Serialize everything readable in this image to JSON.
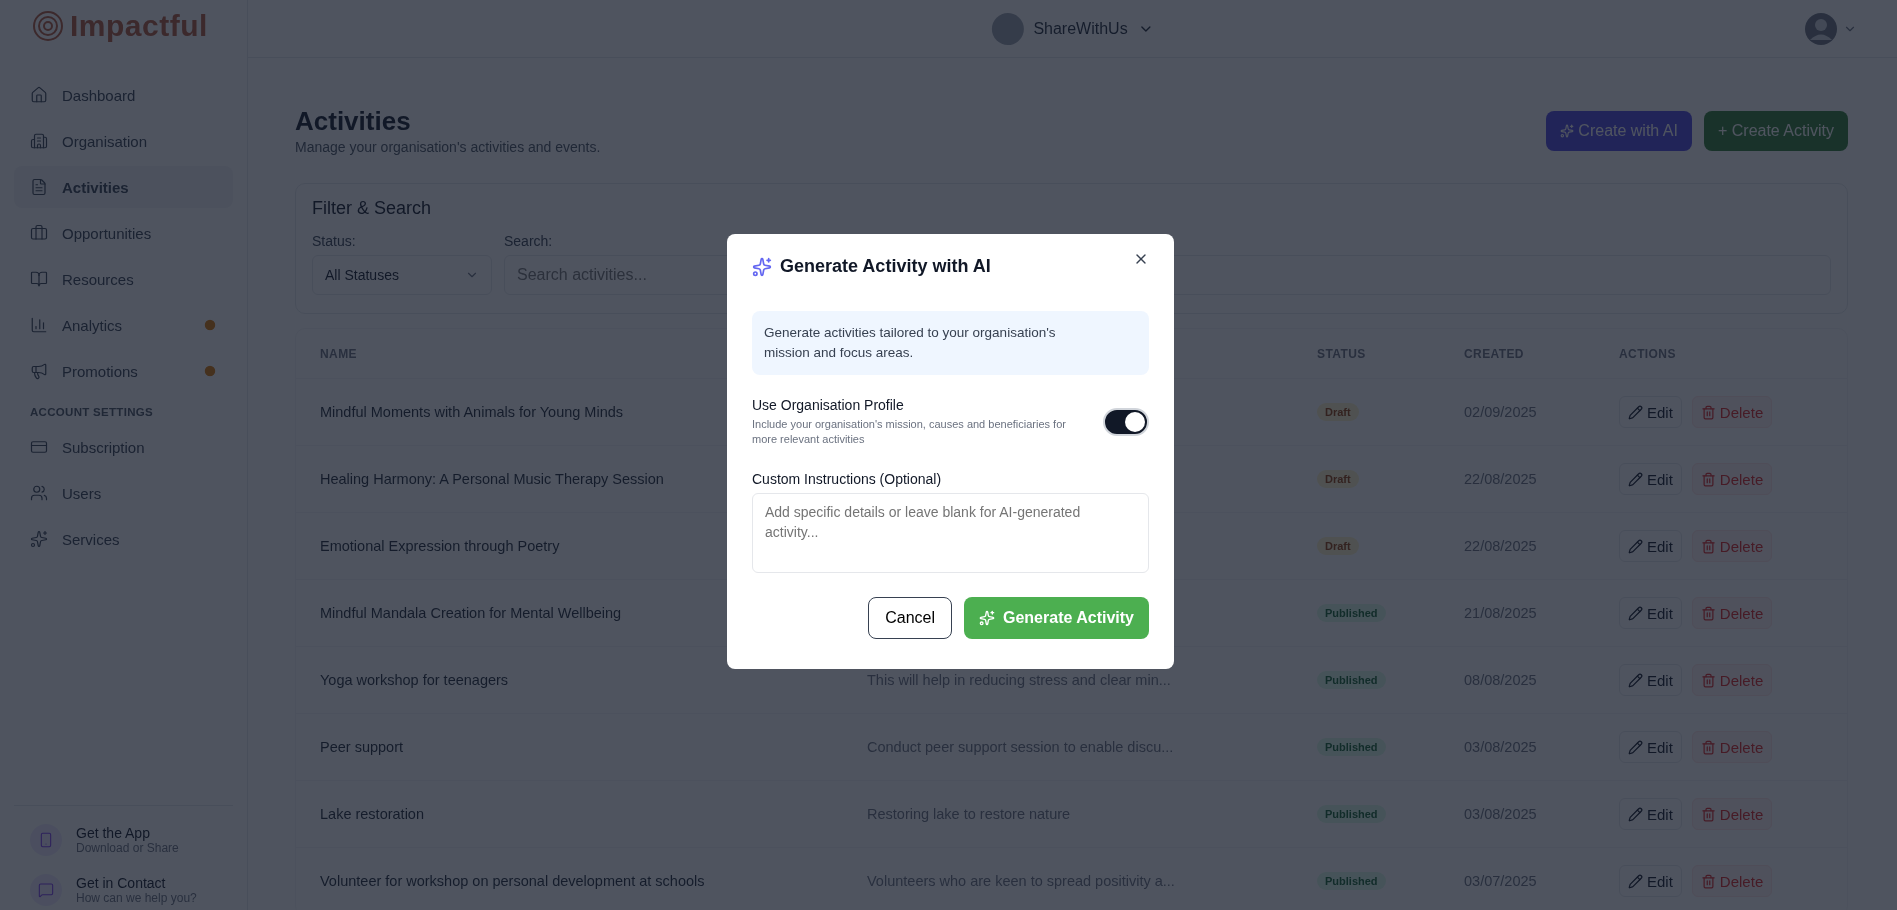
{
  "brand": {
    "name": "Impactful"
  },
  "header": {
    "organisation": "ShareWithUs"
  },
  "sidebar": {
    "items": [
      {
        "label": "Dashboard",
        "selected": false,
        "badge": false
      },
      {
        "label": "Organisation",
        "selected": false,
        "badge": false
      },
      {
        "label": "Activities",
        "selected": true,
        "badge": false
      },
      {
        "label": "Opportunities",
        "selected": false,
        "badge": false
      },
      {
        "label": "Resources",
        "selected": false,
        "badge": false
      },
      {
        "label": "Analytics",
        "selected": false,
        "badge": true
      },
      {
        "label": "Promotions",
        "selected": false,
        "badge": true
      }
    ],
    "section_title": "ACCOUNT SETTINGS",
    "settings_items": [
      {
        "label": "Subscription",
        "selected": false,
        "badge": false
      },
      {
        "label": "Users",
        "selected": false,
        "badge": false
      },
      {
        "label": "Services",
        "selected": false,
        "badge": false
      }
    ],
    "footer_links": [
      {
        "title": "Get the App",
        "subtitle": "Download or Share"
      },
      {
        "title": "Get in Contact",
        "subtitle": "How can we help you?"
      }
    ]
  },
  "page": {
    "title": "Activities",
    "subtitle": "Manage your organisation's activities and events.",
    "buttons": [
      {
        "label": "Create with AI",
        "kind": "ai"
      },
      {
        "label": "+ Create Activity",
        "kind": "create"
      }
    ]
  },
  "filter": {
    "title": "Filter & Search",
    "status_label": "Status:",
    "status_value": "All Statuses",
    "search_label": "Search:",
    "search_placeholder": "Search activities..."
  },
  "table": {
    "columns": {
      "name": "NAME",
      "status": "STATUS",
      "created": "CREATED",
      "actions": "ACTIONS"
    },
    "rows": [
      {
        "name": "Mindful Moments with Animals for Young Minds",
        "status": "Draft",
        "kind": "draft",
        "created": "02/09/2025",
        "edit": "Edit",
        "delete": "Delete"
      },
      {
        "name": "Healing Harmony: A Personal Music Therapy Session",
        "status": "Draft",
        "kind": "draft",
        "created": "22/08/2025",
        "edit": "Edit",
        "delete": "Delete"
      },
      {
        "name": "Emotional Expression through Poetry",
        "status": "Draft",
        "kind": "draft",
        "created": "22/08/2025",
        "edit": "Edit",
        "delete": "Delete"
      },
      {
        "name": "Mindful Mandala Creation for Mental Wellbeing",
        "status": "Published",
        "kind": "published",
        "created": "21/08/2025",
        "edit": "Edit",
        "delete": "Delete"
      },
      {
        "name": "Yoga workshop for teenagers",
        "description": "This will help in reducing stress and clear min...",
        "status": "Published",
        "kind": "published",
        "created": "08/08/2025",
        "edit": "Edit",
        "delete": "Delete"
      },
      {
        "name": "Peer support",
        "description": "Conduct peer support session to enable discu...",
        "status": "Published",
        "kind": "published",
        "created": "03/08/2025",
        "edit": "Edit",
        "delete": "Delete"
      },
      {
        "name": "Lake restoration",
        "description": "Restoring lake to restore nature",
        "status": "Published",
        "kind": "published",
        "created": "03/08/2025",
        "edit": "Edit",
        "delete": "Delete"
      },
      {
        "name": "Volunteer for workshop on personal development at schools",
        "description": "Volunteers who are keen to spread positivity a...",
        "status": "Published",
        "kind": "published",
        "created": "03/07/2025",
        "edit": "Edit",
        "delete": "Delete"
      }
    ]
  },
  "modal": {
    "title": "Generate Activity with AI",
    "info": "Generate activities tailored to your organisation's mission and focus areas.",
    "use_profile": {
      "label": "Use Organisation Profile",
      "hint": "Include your organisation's mission, causes and beneficiaries for more relevant activities",
      "on": true
    },
    "instructions_label": "Custom Instructions (Optional)",
    "instructions_placeholder": "Add specific details or leave blank for AI-generated activity...",
    "cancel": "Cancel",
    "generate": "Generate Activity"
  }
}
